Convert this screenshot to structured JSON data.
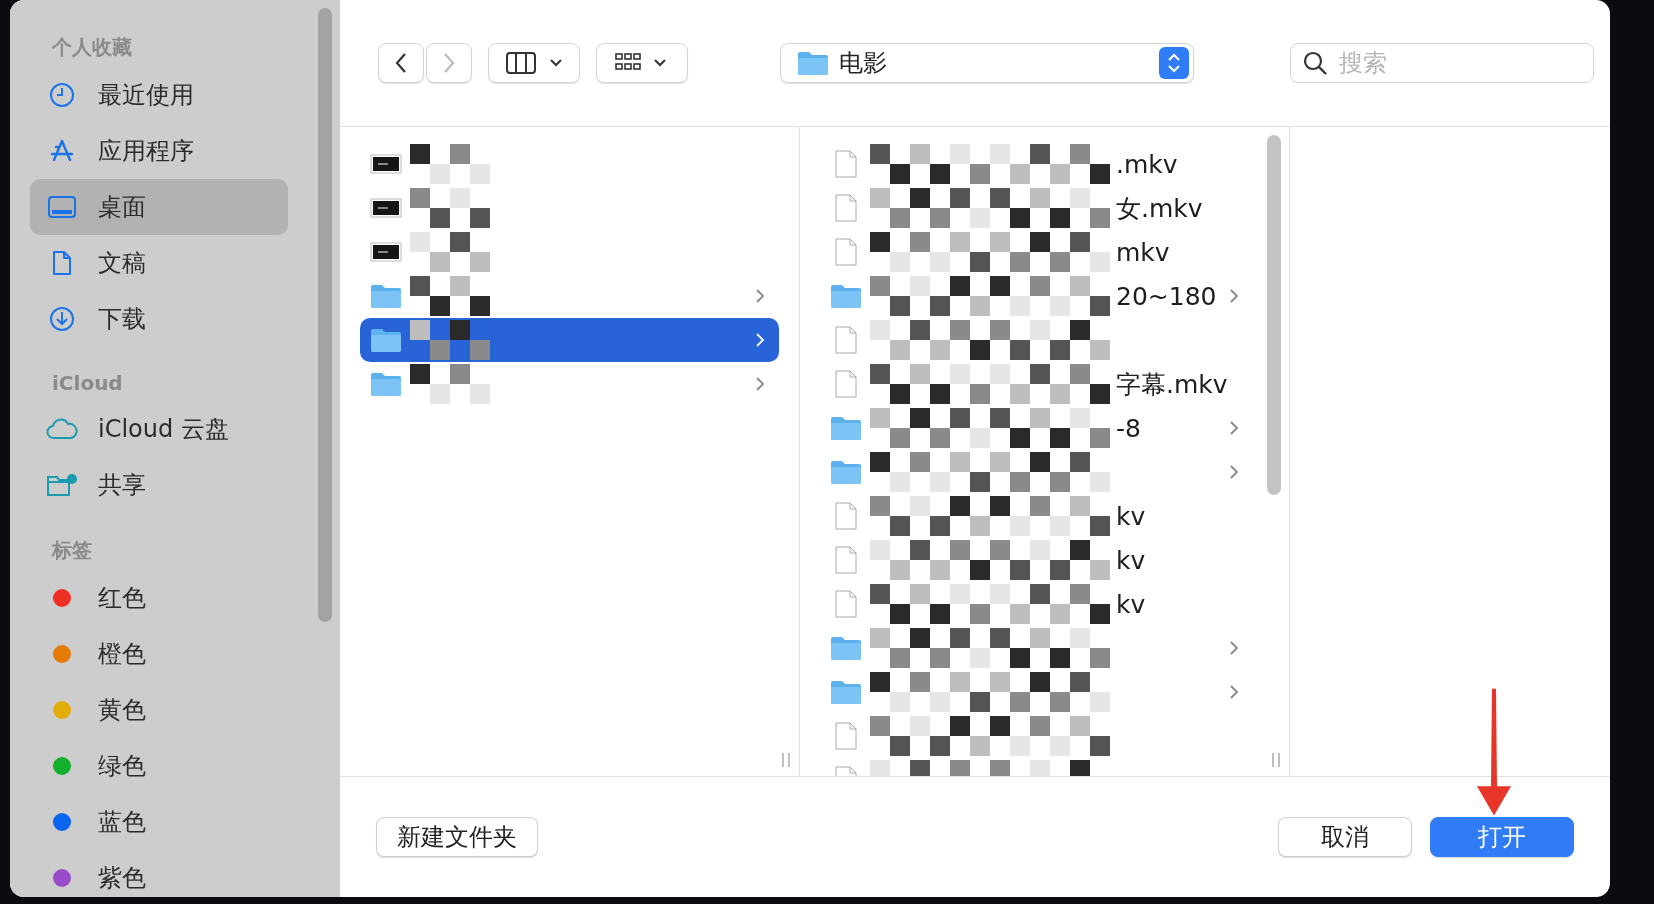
{
  "sidebar": {
    "sections": [
      {
        "title": "个人收藏",
        "items": [
          {
            "label": "最近使用",
            "selected": false
          },
          {
            "label": "应用程序",
            "selected": false
          },
          {
            "label": "桌面",
            "selected": true
          },
          {
            "label": "文稿",
            "selected": false
          },
          {
            "label": "下载",
            "selected": false
          }
        ]
      },
      {
        "title": "iCloud",
        "items": [
          {
            "label": "iCloud 云盘",
            "selected": false
          },
          {
            "label": "共享",
            "selected": false
          }
        ]
      },
      {
        "title": "标签",
        "items": [
          {
            "label": "红色",
            "color": "#ee3024",
            "selected": false
          },
          {
            "label": "橙色",
            "color": "#e57a06",
            "selected": false
          },
          {
            "label": "黄色",
            "color": "#e2ad08",
            "selected": false
          },
          {
            "label": "绿色",
            "color": "#12b02c",
            "selected": false
          },
          {
            "label": "蓝色",
            "color": "#0a64f0",
            "selected": false
          },
          {
            "label": "紫色",
            "color": "#9a4bc8",
            "selected": false
          }
        ]
      }
    ]
  },
  "toolbar": {
    "location": "电影",
    "search": {
      "placeholder": "搜索"
    }
  },
  "columns": [
    {
      "rows": [
        {
          "kind": "image",
          "selected": false
        },
        {
          "kind": "image",
          "selected": false
        },
        {
          "kind": "image",
          "selected": false
        },
        {
          "kind": "folder",
          "selected": false
        },
        {
          "kind": "folder",
          "selected": true
        },
        {
          "kind": "folder",
          "selected": false
        }
      ]
    },
    {
      "rows": [
        {
          "kind": "file",
          "fragment": ".mkv",
          "selected": false
        },
        {
          "kind": "file",
          "fragment": "女.mkv",
          "selected": false
        },
        {
          "kind": "file",
          "fragment": "mkv",
          "selected": false
        },
        {
          "kind": "folder",
          "fragment": "20~180",
          "selected": false
        },
        {
          "kind": "file",
          "selected": false
        },
        {
          "kind": "file",
          "fragment": "字幕.mkv",
          "selected": false
        },
        {
          "kind": "folder",
          "fragment": "-8",
          "selected": false
        },
        {
          "kind": "folder",
          "selected": false
        },
        {
          "kind": "file",
          "fragment": "kv",
          "selected": false
        },
        {
          "kind": "file",
          "fragment": "kv",
          "selected": false
        },
        {
          "kind": "file",
          "fragment": "kv",
          "selected": false
        },
        {
          "kind": "folder",
          "selected": false
        },
        {
          "kind": "folder",
          "selected": false
        },
        {
          "kind": "file",
          "selected": false
        },
        {
          "kind": "file",
          "selected": false
        }
      ]
    }
  ],
  "buttons": {
    "new_folder": "新建文件夹",
    "cancel": "取消",
    "open": "打开"
  }
}
